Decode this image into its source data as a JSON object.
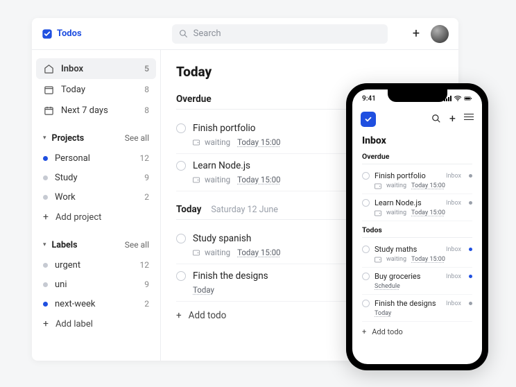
{
  "app": {
    "logo_text": "Todos",
    "search_placeholder": "Search"
  },
  "sidebar": {
    "nav": [
      {
        "label": "Inbox",
        "count": "5",
        "active": true
      },
      {
        "label": "Today",
        "count": "8",
        "active": false
      },
      {
        "label": "Next 7 days",
        "count": "8",
        "active": false
      }
    ],
    "projects_title": "Projects",
    "see_all": "See all",
    "projects": [
      {
        "label": "Personal",
        "count": "12",
        "color": "blue"
      },
      {
        "label": "Study",
        "count": "9",
        "color": "grey"
      },
      {
        "label": "Work",
        "count": "2",
        "color": "grey"
      }
    ],
    "add_project": "Add project",
    "labels_title": "Labels",
    "labels": [
      {
        "label": "urgent",
        "count": "12",
        "color": "grey"
      },
      {
        "label": "uni",
        "count": "9",
        "color": "grey"
      },
      {
        "label": "next-week",
        "count": "2",
        "color": "blue"
      }
    ],
    "add_label": "Add label"
  },
  "main": {
    "title": "Today",
    "groups": [
      {
        "title": "Overdue",
        "sub": "",
        "tasks": [
          {
            "title": "Finish portfolio",
            "tag": "waiting",
            "due": "Today 15:00"
          },
          {
            "title": "Learn Node.js",
            "tag": "waiting",
            "due": "Today 15:00"
          }
        ]
      },
      {
        "title": "Today",
        "sub": "Saturday 12 June",
        "tasks": [
          {
            "title": "Study spanish",
            "tag": "waiting",
            "due": "Today 15:00"
          },
          {
            "title": "Finish the designs",
            "tag": "",
            "due": "Today"
          }
        ]
      }
    ],
    "add_todo": "Add todo"
  },
  "phone": {
    "time": "9:41",
    "title": "Inbox",
    "groups": [
      {
        "title": "Overdue",
        "tasks": [
          {
            "title": "Finish portfolio",
            "tag": "waiting",
            "due": "Today 15:00",
            "project": "Inbox",
            "color": "grey"
          },
          {
            "title": "Learn Node.js",
            "tag": "waiting",
            "due": "Today 15:00",
            "project": "Inbox",
            "color": "grey"
          }
        ]
      },
      {
        "title": "Todos",
        "tasks": [
          {
            "title": "Study maths",
            "tag": "waiting",
            "due": "Today 15:00",
            "project": "Inbox",
            "color": "blue"
          },
          {
            "title": "Buy groceries",
            "tag": "",
            "due": "Schedule",
            "project": "Inbox",
            "color": "blue"
          },
          {
            "title": "Finish the designs",
            "tag": "",
            "due": "Today",
            "project": "Inbox",
            "color": "grey"
          }
        ]
      }
    ],
    "add_todo": "Add todo"
  }
}
